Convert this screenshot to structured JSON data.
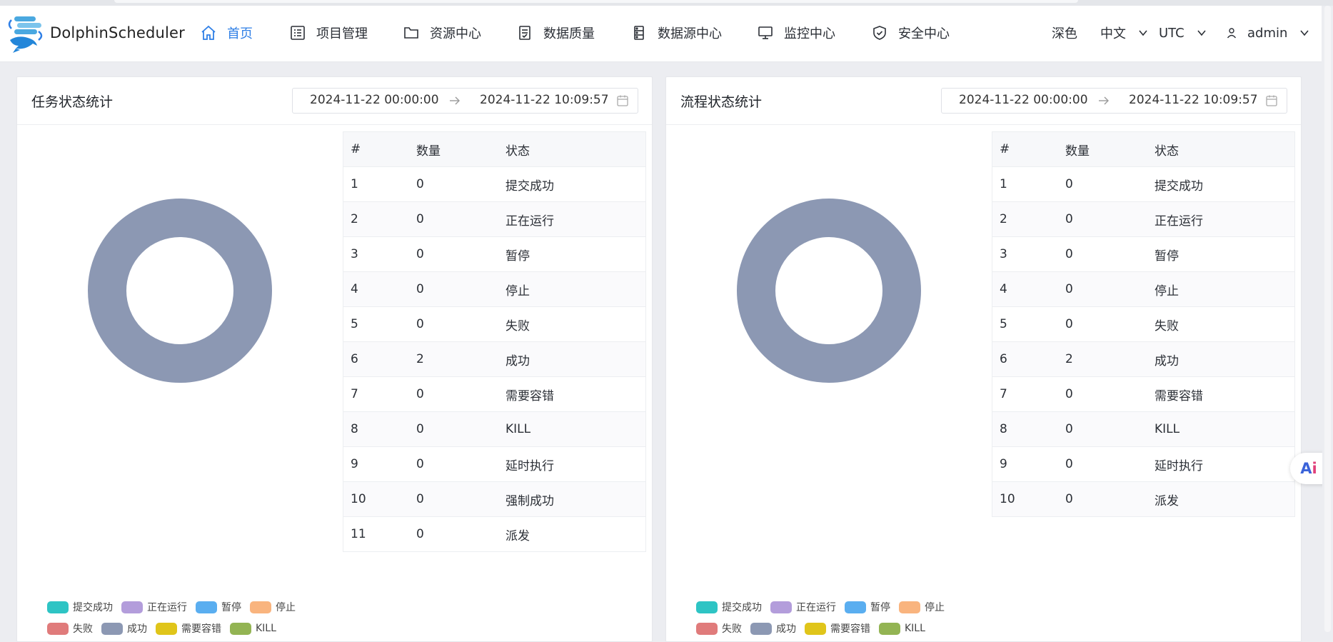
{
  "app": {
    "name": "DolphinScheduler"
  },
  "nav": [
    {
      "label": "首页",
      "icon": "home-icon",
      "active": true
    },
    {
      "label": "项目管理",
      "icon": "list-icon"
    },
    {
      "label": "资源中心",
      "icon": "folder-icon"
    },
    {
      "label": "数据质量",
      "icon": "document-icon"
    },
    {
      "label": "数据源中心",
      "icon": "database-icon"
    },
    {
      "label": "监控中心",
      "icon": "monitor-icon"
    },
    {
      "label": "安全中心",
      "icon": "shield-icon"
    }
  ],
  "header_right": {
    "theme": "深色",
    "language": "中文",
    "timezone": "UTC",
    "user": "admin"
  },
  "task_panel": {
    "title": "任务状态统计",
    "start": "2024-11-22 00:00:00",
    "end": "2024-11-22 10:09:57",
    "columns": [
      "#",
      "数量",
      "状态"
    ],
    "rows": [
      [
        "1",
        "0",
        "提交成功"
      ],
      [
        "2",
        "0",
        "正在运行"
      ],
      [
        "3",
        "0",
        "暂停"
      ],
      [
        "4",
        "0",
        "停止"
      ],
      [
        "5",
        "0",
        "失败"
      ],
      [
        "6",
        "2",
        "成功"
      ],
      [
        "7",
        "0",
        "需要容错"
      ],
      [
        "8",
        "0",
        "KILL"
      ],
      [
        "9",
        "0",
        "延时执行"
      ],
      [
        "10",
        "0",
        "强制成功"
      ],
      [
        "11",
        "0",
        "派发"
      ]
    ]
  },
  "process_panel": {
    "title": "流程状态统计",
    "start": "2024-11-22 00:00:00",
    "end": "2024-11-22 10:09:57",
    "columns": [
      "#",
      "数量",
      "状态"
    ],
    "rows": [
      [
        "1",
        "0",
        "提交成功"
      ],
      [
        "2",
        "0",
        "正在运行"
      ],
      [
        "3",
        "0",
        "暂停"
      ],
      [
        "4",
        "0",
        "停止"
      ],
      [
        "5",
        "0",
        "失败"
      ],
      [
        "6",
        "2",
        "成功"
      ],
      [
        "7",
        "0",
        "需要容错"
      ],
      [
        "8",
        "0",
        "KILL"
      ],
      [
        "9",
        "0",
        "延时执行"
      ],
      [
        "10",
        "0",
        "派发"
      ]
    ]
  },
  "legend": [
    {
      "label": "提交成功",
      "color": "#2ec4c4"
    },
    {
      "label": "正在运行",
      "color": "#b39ddb"
    },
    {
      "label": "暂停",
      "color": "#5aaef0"
    },
    {
      "label": "停止",
      "color": "#f9b47e"
    },
    {
      "label": "失败",
      "color": "#e07b7b"
    },
    {
      "label": "成功",
      "color": "#8c98b3"
    },
    {
      "label": "需要容错",
      "color": "#e0c51a"
    },
    {
      "label": "KILL",
      "color": "#93b453"
    }
  ],
  "donut_color": "#8c98b3",
  "ai_button": {
    "a": "A",
    "i": "i"
  }
}
